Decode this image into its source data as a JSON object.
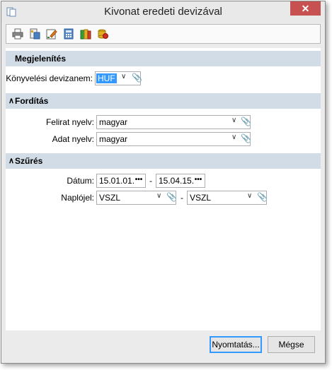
{
  "window": {
    "title": "Kivonat eredeti devizával",
    "close_label": "✕"
  },
  "toolbar": {
    "icons": [
      "print-icon",
      "export-icon",
      "edit-icon",
      "calculator-icon",
      "archive-icon",
      "database-icon"
    ]
  },
  "sections": {
    "display": {
      "title": "Megjelenítés",
      "currency_label": "Könyvelési devizanem:",
      "currency_value": "HUF"
    },
    "translation": {
      "title": "Fordítás",
      "caption_lang_label": "Felirat nyelv:",
      "caption_lang_value": "magyar",
      "data_lang_label": "Adat nyelv:",
      "data_lang_value": "magyar"
    },
    "filter": {
      "title": "Szűrés",
      "date_label": "Dátum:",
      "date_from": "15.01.01.",
      "date_to": "15.04.15.",
      "journal_label": "Naplójel:",
      "journal_from": "VSZL",
      "journal_to": "VSZL",
      "separator": "-"
    }
  },
  "buttons": {
    "print": "Nyomtatás...",
    "cancel": "Mégse"
  },
  "colors": {
    "section_bg": "#d1dce6",
    "close_bg": "#c75050",
    "accent": "#3399ff"
  }
}
